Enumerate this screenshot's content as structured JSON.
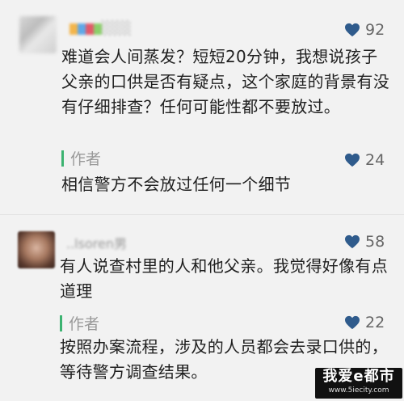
{
  "comments": [
    {
      "username": "░░░",
      "likes": "92",
      "text": "难道会人间蒸发？短短20分钟，我想说孩子父亲的口供是否有疑点，这个家庭的背景有没有仔细排查？任何可能性都不要放过。",
      "reply": {
        "author_label": "作者",
        "likes": "24",
        "text": "相信警方不会放过任何一个细节"
      }
    },
    {
      "username": "..lsoren男",
      "likes": "58",
      "text": "有人说查村里的人和他父亲。我觉得好像有点道理",
      "reply": {
        "author_label": "作者",
        "likes": "22",
        "text": "按照办案流程，涉及的人员都会去录口供的，等待警方调查结果。"
      }
    }
  ],
  "watermark": {
    "title": "我爱e都市",
    "url": "www.5iecity.com"
  },
  "colors": {
    "author_bar": "#3cb371",
    "like_icon": "#2f5b8c"
  },
  "icons": {
    "like": "heart-icon"
  }
}
